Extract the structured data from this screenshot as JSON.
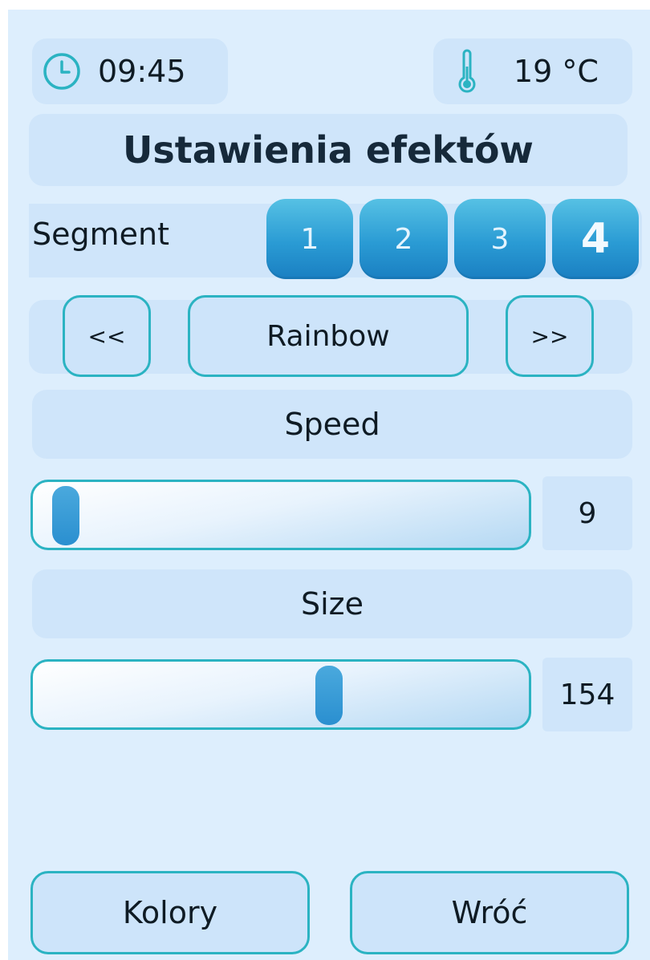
{
  "status": {
    "time": "09:45",
    "temperature": "19 °C",
    "clock_icon": "clock-icon",
    "thermometer_icon": "thermometer-icon"
  },
  "header": {
    "title": "Ustawienia efektów"
  },
  "segment": {
    "label": "Segment",
    "buttons": [
      "1",
      "2",
      "3",
      "4"
    ],
    "active": "4"
  },
  "effect": {
    "prev_label": "<<",
    "name": "Rainbow",
    "next_label": ">>"
  },
  "speed": {
    "label": "Speed",
    "value": "9",
    "fraction": 0.035
  },
  "size": {
    "label": "Size",
    "value": "154",
    "fraction": 0.604
  },
  "footer": {
    "colors_label": "Kolory",
    "back_label": "Wróć"
  },
  "colors": {
    "accent": "#2bb3c2",
    "button": "#2a9bd4",
    "panel": "#cfe5fa",
    "background": "#ddeefd"
  }
}
